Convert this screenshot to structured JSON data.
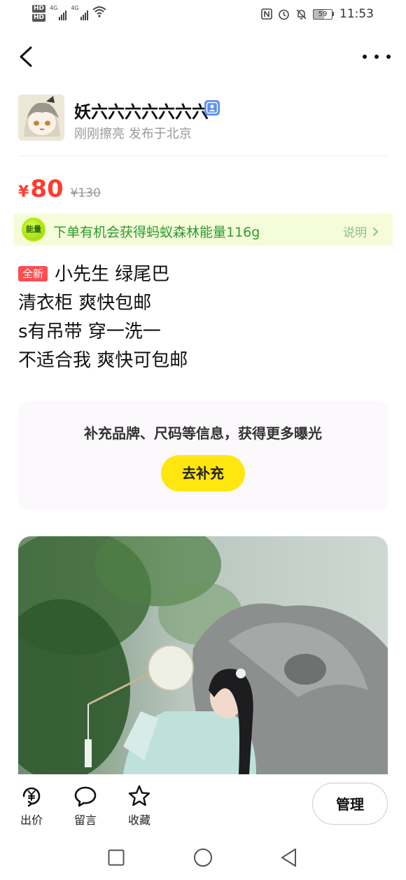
{
  "status_bar": {
    "hd_badges": [
      "HD",
      "HD"
    ],
    "network_1": "4G",
    "network_2": "4G",
    "battery": "59",
    "time": "11:53",
    "icons": [
      "nfc-icon",
      "alarm-icon",
      "mute-icon",
      "battery-icon",
      "wifi-icon"
    ]
  },
  "seller": {
    "name": "妖六六六六六六六",
    "meta": "刚刚擦亮 发布于北京"
  },
  "price": {
    "currency": "¥",
    "value": "80",
    "original": "¥130"
  },
  "energy_banner": {
    "badge": "能量",
    "text": "下单有机会获得蚂蚁森林能量116g",
    "link": "说明"
  },
  "description": {
    "tag": "全新",
    "lines": [
      "小先生  绿尾巴",
      "清衣柜   爽快包邮",
      "s有吊带  穿一洗一",
      "不适合我  爽快可包邮"
    ]
  },
  "supplement": {
    "text": "补充品牌、尺码等信息，获得更多曝光",
    "button": "去补充"
  },
  "actions": {
    "offer": "出价",
    "comment": "留言",
    "favorite": "收藏",
    "manage": "管理"
  },
  "colors": {
    "price": "#ff3b30",
    "energy_bg": "#f4fcd9",
    "energy_text": "#2e9a2e",
    "button_yellow": "#ffe60f",
    "tag_red": "#ff4d4f"
  }
}
